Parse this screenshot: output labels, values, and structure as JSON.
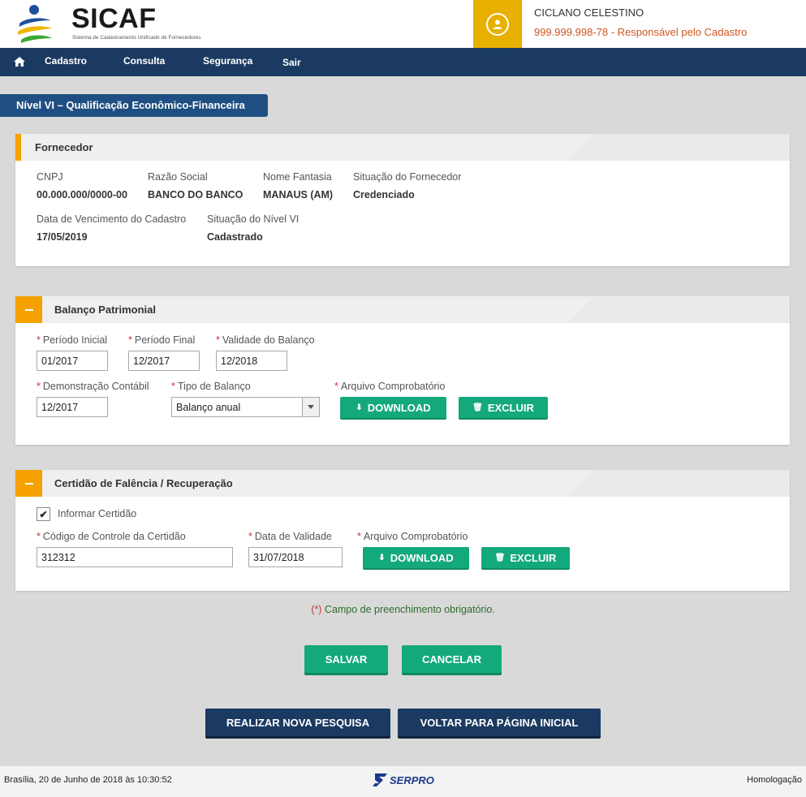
{
  "header": {
    "brand": "SICAF",
    "brand_subtitle": "Sistema de Cadastramento Unificado de Fornecedores",
    "user_name": "CICLANO CELESTINO",
    "user_role": "999.999.998-78 - Responsável pelo Cadastro"
  },
  "nav": {
    "items": [
      "Cadastro",
      "Consulta",
      "Segurança",
      "Sair"
    ]
  },
  "page_title": "Nível VI – Qualificação Econômico-Financeira",
  "fornecedor": {
    "title": "Fornecedor",
    "fields": [
      {
        "label": "CNPJ",
        "value": "00.000.000/0000-00"
      },
      {
        "label": "Razão Social",
        "value": "BANCO DO BANCO"
      },
      {
        "label": "Nome Fantasia",
        "value": "MANAUS (AM)"
      },
      {
        "label": "Situação do Fornecedor",
        "value": "Credenciado"
      },
      {
        "label": "Data de Vencimento do Cadastro",
        "value": "17/05/2019"
      },
      {
        "label": "Situação do Nível VI",
        "value": "Cadastrado"
      }
    ]
  },
  "balanco": {
    "title": "Balanço Patrimonial",
    "periodo_inicial": {
      "label": "Período Inicial",
      "value": "01/2017"
    },
    "periodo_final": {
      "label": "Período Final",
      "value": "12/2017"
    },
    "validade": {
      "label": "Validade do Balanço",
      "value": "12/2018"
    },
    "demonstracao": {
      "label": "Demonstração Contábil",
      "value": "12/2017"
    },
    "tipo": {
      "label": "Tipo de Balanço",
      "value": "Balanço anual"
    },
    "arquivo_label": "Arquivo Comprobatório",
    "download": "DOWNLOAD",
    "excluir": "EXCLUIR"
  },
  "certidao": {
    "title": "Certidão de Falência / Recuperação",
    "checkbox_label": "Informar Certidão",
    "codigo": {
      "label": "Código de Controle da Certidão",
      "value": "312312"
    },
    "data_validade": {
      "label": "Data de Validade",
      "value": "31/07/2018"
    },
    "arquivo_label": "Arquivo Comprobatório",
    "download": "DOWNLOAD",
    "excluir": "EXCLUIR"
  },
  "required_note": {
    "mark": "(*)",
    "text": " Campo de preenchimento obrigatório."
  },
  "actions": {
    "salvar": "SALVAR",
    "cancelar": "CANCELAR",
    "nova_pesquisa": "REALIZAR NOVA PESQUISA",
    "pagina_inicial": "VOLTAR PARA PÁGINA INICIAL"
  },
  "footer": {
    "date": "Brasília, 20 de Junho de 2018 às 10:30:52",
    "logo_text": "SERPRO",
    "environment": "Homologação"
  },
  "colors": {
    "navy": "#1b3a61",
    "orange": "#f5a200",
    "green": "#14a97c",
    "role_text": "#d0561f"
  }
}
